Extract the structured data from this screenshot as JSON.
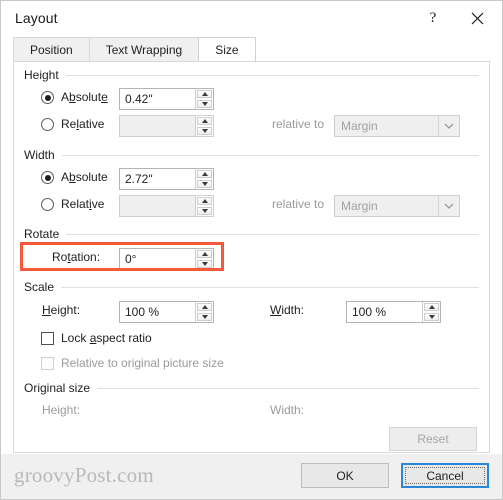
{
  "window": {
    "title": "Layout",
    "help_icon": "question-mark-icon",
    "close_icon": "close-icon"
  },
  "tabs": [
    {
      "label": "Position",
      "active": false
    },
    {
      "label": "Text Wrapping",
      "active": false
    },
    {
      "label": "Size",
      "active": true
    }
  ],
  "groups": {
    "height": {
      "title": "Height",
      "absolute_label": "Absolute",
      "absolute_value": "0.42\"",
      "absolute_selected": true,
      "relative_label": "Relative",
      "relative_value": "",
      "relative_selected": false,
      "relative_to_label": "relative to",
      "relative_to_value": "Margin"
    },
    "width": {
      "title": "Width",
      "absolute_label": "Absolute",
      "absolute_value": "2.72\"",
      "absolute_selected": true,
      "relative_label": "Relative",
      "relative_value": "",
      "relative_selected": false,
      "relative_to_label": "relative to",
      "relative_to_value": "Margin"
    },
    "rotate": {
      "title": "Rotate",
      "rotation_label": "Rotation:",
      "rotation_value": "0°",
      "highlight_color": "#f4593c"
    },
    "scale": {
      "title": "Scale",
      "height_label": "Height:",
      "height_value": "100 %",
      "width_label": "Width:",
      "width_value": "100 %",
      "lock_aspect_label": "Lock aspect ratio",
      "lock_aspect_checked": false,
      "relative_original_label": "Relative to original picture size",
      "relative_original_checked": false
    },
    "original_size": {
      "title": "Original size",
      "height_label": "Height:",
      "height_value": "",
      "width_label": "Width:",
      "width_value": "",
      "reset_label": "Reset"
    }
  },
  "footer": {
    "watermark": "groovyPost.com",
    "ok_label": "OK",
    "cancel_label": "Cancel"
  }
}
